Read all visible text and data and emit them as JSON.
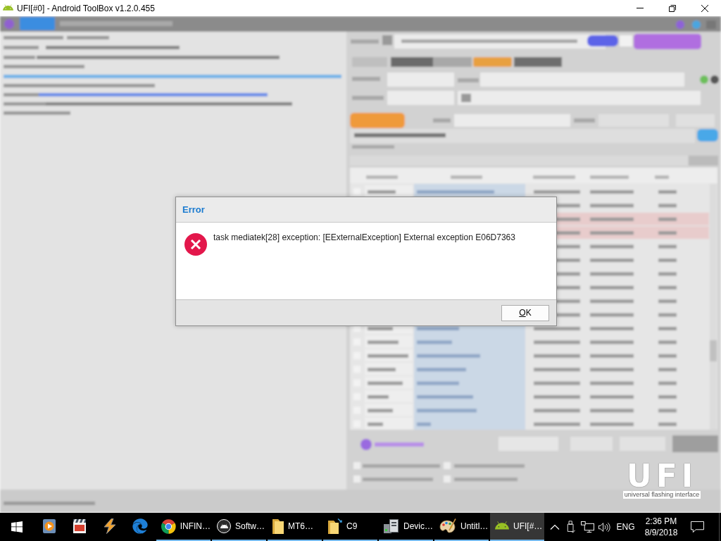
{
  "window": {
    "title": "UFI[#0] - Android ToolBox v1.2.0.455"
  },
  "dialog": {
    "title": "Error",
    "message": "task mediatek[28] exception: [EExternalException] External exception E06D7363",
    "buttons": [
      {
        "label": "OK",
        "mnemonic": true
      }
    ]
  },
  "logo": {
    "wordmark": "UFI",
    "tagline": "universal flashing interface"
  },
  "taskbar": {
    "apps": [
      {
        "kind": "player",
        "running": false,
        "selected": false
      },
      {
        "kind": "clapper",
        "running": false,
        "selected": false
      },
      {
        "kind": "bolt",
        "running": false,
        "selected": false
      },
      {
        "kind": "edge",
        "running": false,
        "selected": false
      },
      {
        "kind": "chrome",
        "label": "INFIN…",
        "running": true,
        "selected": false
      },
      {
        "kind": "disc",
        "label": "Softw…",
        "running": true,
        "selected": false
      },
      {
        "kind": "folder",
        "label": "MT6…",
        "running": true,
        "selected": false
      },
      {
        "kind": "shortcut",
        "label": "C9",
        "running": true,
        "selected": false
      },
      {
        "kind": "computer",
        "label": "Devic…",
        "running": true,
        "selected": false
      },
      {
        "kind": "palette",
        "label": "Untitl…",
        "running": true,
        "selected": false
      },
      {
        "kind": "android",
        "label": "UFI[#…",
        "running": true,
        "selected": true
      }
    ],
    "tray": {
      "language": "ENG",
      "time": "2:36 PM",
      "date": "8/9/2018"
    }
  }
}
